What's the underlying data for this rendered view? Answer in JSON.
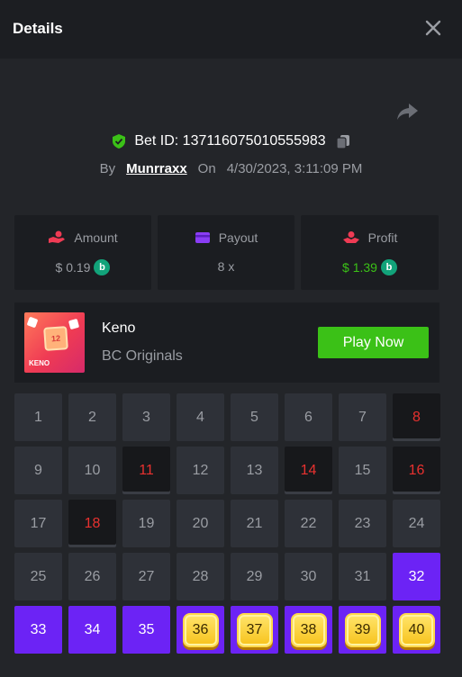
{
  "header": {
    "title": "Details"
  },
  "bet": {
    "id_text": "Bet ID: 137116075010555983",
    "by_label": "By",
    "username": "Munrraxx",
    "on_label": "On",
    "datetime": "4/30/2023, 3:11:09 PM"
  },
  "stats": {
    "amount": {
      "label": "Amount",
      "value": "$ 0.19",
      "icon": "hand-coin-icon",
      "coin": "b"
    },
    "payout": {
      "label": "Payout",
      "value": "8 x",
      "icon": "card-icon"
    },
    "profit": {
      "label": "Profit",
      "value": "$ 1.39",
      "icon": "profit-icon",
      "coin": "b"
    }
  },
  "game": {
    "name": "Keno",
    "provider": "BC Originals",
    "play_label": "Play Now",
    "thumb_number": "12",
    "thumb_brand": "KENO"
  },
  "grid": [
    {
      "n": "1",
      "state": "normal"
    },
    {
      "n": "2",
      "state": "normal"
    },
    {
      "n": "3",
      "state": "normal"
    },
    {
      "n": "4",
      "state": "normal"
    },
    {
      "n": "5",
      "state": "normal"
    },
    {
      "n": "6",
      "state": "normal"
    },
    {
      "n": "7",
      "state": "normal"
    },
    {
      "n": "8",
      "state": "miss"
    },
    {
      "n": "9",
      "state": "normal"
    },
    {
      "n": "10",
      "state": "normal"
    },
    {
      "n": "11",
      "state": "miss"
    },
    {
      "n": "12",
      "state": "normal"
    },
    {
      "n": "13",
      "state": "normal"
    },
    {
      "n": "14",
      "state": "miss"
    },
    {
      "n": "15",
      "state": "normal"
    },
    {
      "n": "16",
      "state": "miss"
    },
    {
      "n": "17",
      "state": "normal"
    },
    {
      "n": "18",
      "state": "miss"
    },
    {
      "n": "19",
      "state": "normal"
    },
    {
      "n": "20",
      "state": "normal"
    },
    {
      "n": "21",
      "state": "normal"
    },
    {
      "n": "22",
      "state": "normal"
    },
    {
      "n": "23",
      "state": "normal"
    },
    {
      "n": "24",
      "state": "normal"
    },
    {
      "n": "25",
      "state": "normal"
    },
    {
      "n": "26",
      "state": "normal"
    },
    {
      "n": "27",
      "state": "normal"
    },
    {
      "n": "28",
      "state": "normal"
    },
    {
      "n": "29",
      "state": "normal"
    },
    {
      "n": "30",
      "state": "normal"
    },
    {
      "n": "31",
      "state": "normal"
    },
    {
      "n": "32",
      "state": "hit"
    },
    {
      "n": "33",
      "state": "hit"
    },
    {
      "n": "34",
      "state": "hit"
    },
    {
      "n": "35",
      "state": "hit"
    },
    {
      "n": "36",
      "state": "pick"
    },
    {
      "n": "37",
      "state": "pick"
    },
    {
      "n": "38",
      "state": "pick"
    },
    {
      "n": "39",
      "state": "pick"
    },
    {
      "n": "40",
      "state": "pick"
    }
  ],
  "colors": {
    "accent_green": "#3bc117",
    "hit_purple": "#6c23f5",
    "miss_red": "#e8312f",
    "gem_yellow": "#f7c31c"
  }
}
